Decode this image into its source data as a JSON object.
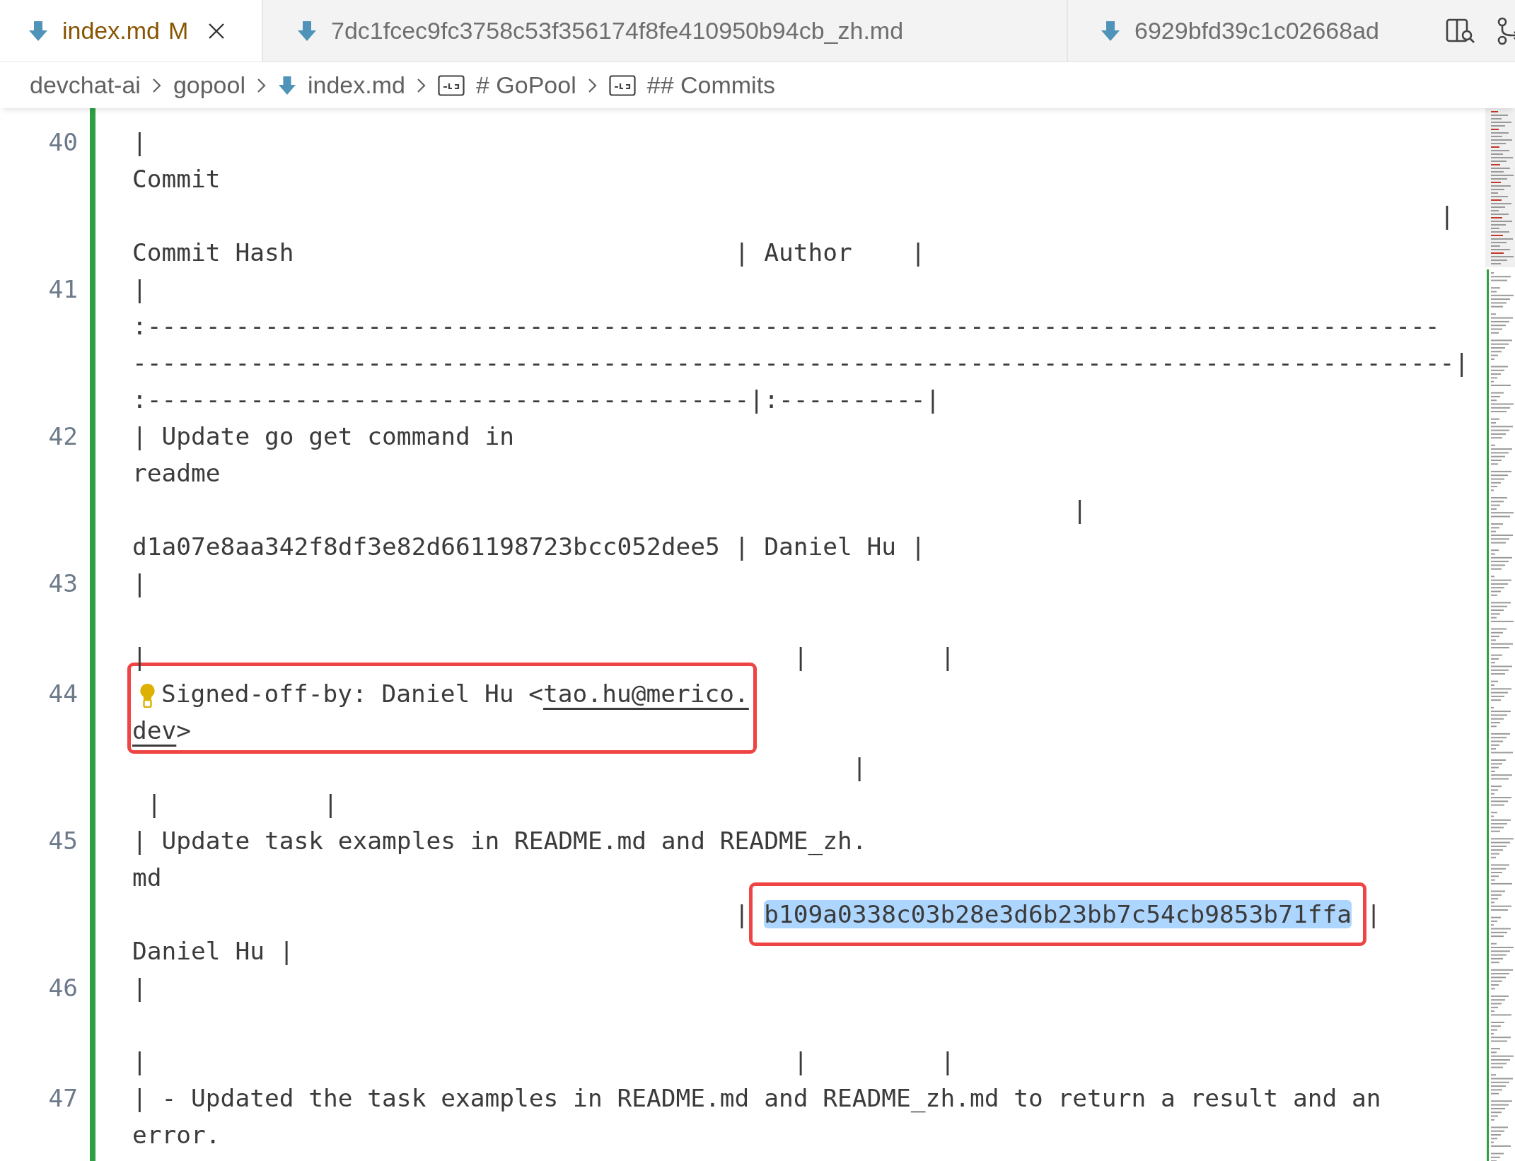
{
  "tabs": [
    {
      "label": "index.md",
      "status": "M",
      "modified": true,
      "selected": true
    },
    {
      "label": "7dc1fcec9fc3758c53f356174f8fe410950b94cb_zh.md",
      "modified": false,
      "selected": false
    },
    {
      "label": "6929bfd39c1c02668ad",
      "modified": false,
      "selected": false
    }
  ],
  "breadcrumbs": [
    {
      "kind": "folder",
      "label": "devchat-ai"
    },
    {
      "kind": "folder",
      "label": "gopool"
    },
    {
      "kind": "file",
      "label": "index.md"
    },
    {
      "kind": "heading",
      "label": "# GoPool"
    },
    {
      "kind": "heading",
      "label": "## Commits"
    }
  ],
  "editor": {
    "rows": [
      {
        "kind": "line",
        "number": "40",
        "text": "|"
      },
      {
        "kind": "line",
        "text": "Commit"
      },
      {
        "kind": "line",
        "text": "                                                                                         |"
      },
      {
        "kind": "line",
        "text": "Commit Hash                              | Author    |"
      },
      {
        "kind": "line",
        "number": "41",
        "text": "|"
      },
      {
        "kind": "line",
        "text": ":----------------------------------------------------------------------------------------"
      },
      {
        "kind": "line",
        "text": "------------------------------------------------------------------------------------------|"
      },
      {
        "kind": "line",
        "text": ":-----------------------------------------|:----------|"
      },
      {
        "kind": "line",
        "number": "42",
        "text": "| Update go get command in"
      },
      {
        "kind": "line",
        "text": "readme"
      },
      {
        "kind": "line",
        "text": "                                                                |"
      },
      {
        "kind": "line",
        "text": "d1a07e8aa342f8df3e82d661198723bcc052dee5 | Daniel Hu |"
      },
      {
        "kind": "line",
        "number": "43",
        "text": "|"
      },
      {
        "kind": "blank"
      },
      {
        "kind": "line",
        "text": "|                                            |         |"
      },
      {
        "kind": "boxed_group",
        "rows": [
          {
            "kind": "line",
            "number": "44",
            "segments": [
              {
                "kind": "lightbulb"
              },
              {
                "kind": "text",
                "text": "Signed-off-by: Daniel Hu <"
              },
              {
                "kind": "link",
                "text": "tao.hu@merico."
              }
            ]
          },
          {
            "kind": "line",
            "segments": [
              {
                "kind": "link",
                "text": "dev"
              },
              {
                "kind": "text",
                "text": ">"
              }
            ]
          }
        ]
      },
      {
        "kind": "line",
        "text": "                                                 |"
      },
      {
        "kind": "line",
        "text": " |           |"
      },
      {
        "kind": "line",
        "number": "45",
        "text": "| Update task examples in README.md and README_zh."
      },
      {
        "kind": "line",
        "text": "md"
      },
      {
        "kind": "line",
        "segments": [
          {
            "kind": "text",
            "text": "                                         | "
          },
          {
            "kind": "boxed_match",
            "text": "b109a0338c03b28e3d6b23bb7c54cb9853b71ffa"
          },
          {
            "kind": "text",
            "text": " |"
          }
        ]
      },
      {
        "kind": "line",
        "text": "Daniel Hu |"
      },
      {
        "kind": "line",
        "number": "46",
        "text": "|"
      },
      {
        "kind": "blank"
      },
      {
        "kind": "line",
        "text": "|                                            |         |"
      },
      {
        "kind": "line",
        "number": "47",
        "text": "| - Updated the task examples in README.md and README_zh.md to return a result and an"
      },
      {
        "kind": "line",
        "text": "error."
      }
    ]
  }
}
